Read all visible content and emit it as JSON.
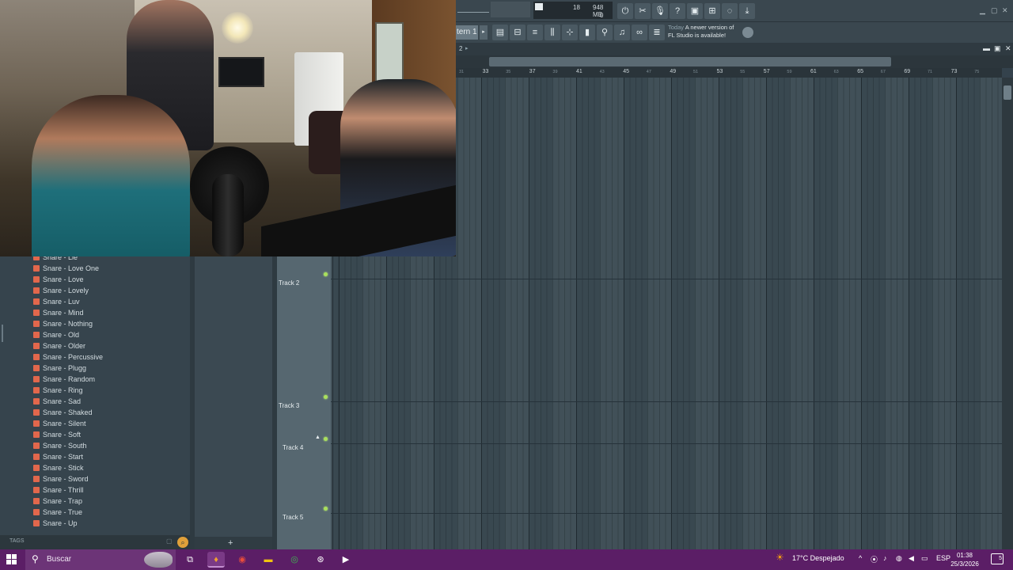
{
  "toolbar": {
    "cpu_count": "18",
    "memory": "948 MB",
    "poly": "0",
    "icons": [
      "power-icon",
      "cut-icon",
      "mic-icon",
      "help-icon",
      "save-icon",
      "mixer-icon",
      "chat-icon",
      "download-icon"
    ]
  },
  "toolbar2": {
    "pattern": "tern 1",
    "news_today": "Today",
    "news_text": "A newer version of",
    "news_text2": "FL Studio is available!"
  },
  "playlist": {
    "header_label": "2",
    "ruler_major": [
      "31",
      "33",
      "35",
      "37",
      "39",
      "41",
      "43",
      "45",
      "47",
      "49",
      "51",
      "53",
      "55",
      "57",
      "59",
      "61",
      "63",
      "65",
      "67",
      "69",
      "71",
      "73",
      "75"
    ],
    "tracks": [
      {
        "label": "Track 2"
      },
      {
        "label": "Track 3"
      },
      {
        "label": "Track 4"
      },
      {
        "label": "Track 5"
      }
    ]
  },
  "browser": {
    "items": [
      "Snare - Lie",
      "Snare - Love One",
      "Snare - Love",
      "Snare - Lovely",
      "Snare - Luv",
      "Snare - Mind",
      "Snare - Nothing",
      "Snare - Old",
      "Snare - Older",
      "Snare - Percussive",
      "Snare - Plugg",
      "Snare - Random",
      "Snare - Ring",
      "Snare - Sad",
      "Snare - Shaked",
      "Snare - Silent",
      "Snare - Soft",
      "Snare - South",
      "Snare - Start",
      "Snare - Stick",
      "Snare - Sword",
      "Snare - Thrill",
      "Snare - Trap",
      "Snare - True",
      "Snare - Up"
    ],
    "tags_label": "TAGS"
  },
  "taskbar": {
    "search_placeholder": "Buscar",
    "weather": "17°C  Despejado",
    "lang": "ESP",
    "time": "01:38",
    "date": "25/3/2026",
    "notifications": "5"
  }
}
